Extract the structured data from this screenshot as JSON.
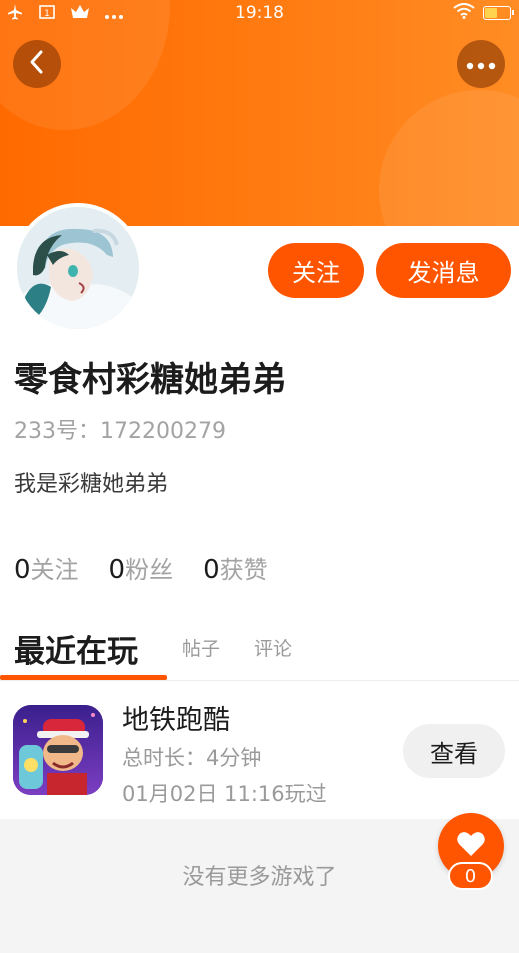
{
  "status_bar": {
    "time": "19:18",
    "left_icons": [
      "airplane-icon",
      "screen-record-icon",
      "crown-icon",
      "more-dots-icon"
    ],
    "right_icons": [
      "wifi-icon",
      "battery-icon"
    ],
    "battery_level": 0.45
  },
  "header": {
    "back_icon": "chevron-left-icon",
    "more_icon": "more-dots-icon"
  },
  "profile": {
    "follow_label": "关注",
    "message_label": "发消息",
    "username": "零食村彩糖她弟弟",
    "id_text": "233号：172200279",
    "bio": "我是彩糖她弟弟"
  },
  "stats": [
    {
      "num": "0",
      "label": "关注"
    },
    {
      "num": "0",
      "label": "粉丝"
    },
    {
      "num": "0",
      "label": "获赞"
    }
  ],
  "tabs": {
    "recent": "最近在玩",
    "posts": "帖子",
    "comments": "评论"
  },
  "games": [
    {
      "title": "地铁跑酷",
      "duration": "总时长：4分钟",
      "last_played": "01月02日 11:16玩过",
      "view_label": "查看"
    }
  ],
  "footer": {
    "no_more": "没有更多游戏了"
  },
  "like": {
    "count": "0"
  },
  "colors": {
    "accent": "#ff5500",
    "header_start": "#ff6a00",
    "header_end": "#ff8c24",
    "muted": "#a3a3a3"
  }
}
